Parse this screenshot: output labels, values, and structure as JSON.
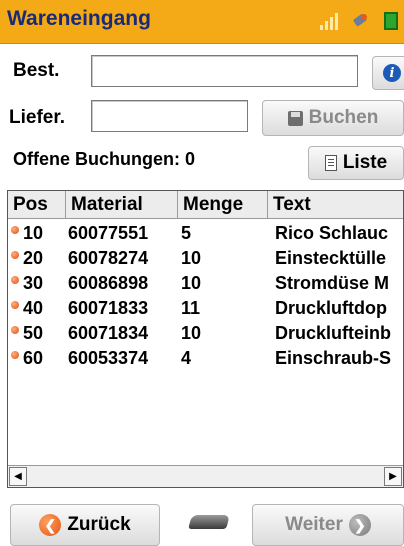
{
  "app": {
    "title": "Wareneingang",
    "accent_color": "#f3aa16",
    "title_color": "#1a2a78",
    "status_icons": [
      "signal-icon",
      "connection-icon",
      "battery-icon"
    ]
  },
  "form": {
    "best_label": "Best.",
    "best_value": "",
    "liefer_label": "Liefer.",
    "liefer_value": "",
    "info_icon": "i",
    "buchen_label": "Buchen",
    "offene_label": "Offene Buchungen: 0",
    "liste_label": "Liste"
  },
  "table": {
    "columns": [
      "Pos",
      "Material",
      "Menge",
      "Text"
    ],
    "rows": [
      {
        "pos": "10",
        "material": "60077551",
        "menge": "5",
        "text": "Rico Schlauc"
      },
      {
        "pos": "20",
        "material": "60078274",
        "menge": "10",
        "text": "Einstecktülle"
      },
      {
        "pos": "30",
        "material": "60086898",
        "menge": "10",
        "text": "Stromdüse M"
      },
      {
        "pos": "40",
        "material": "60071833",
        "menge": "11",
        "text": "Druckluftdop"
      },
      {
        "pos": "50",
        "material": "60071834",
        "menge": "10",
        "text": "Drucklufteinb"
      },
      {
        "pos": "60",
        "material": "60053374",
        "menge": "4",
        "text": "Einschraub-S"
      }
    ]
  },
  "footer": {
    "back_label": "Zurück",
    "next_label": "Weiter"
  }
}
